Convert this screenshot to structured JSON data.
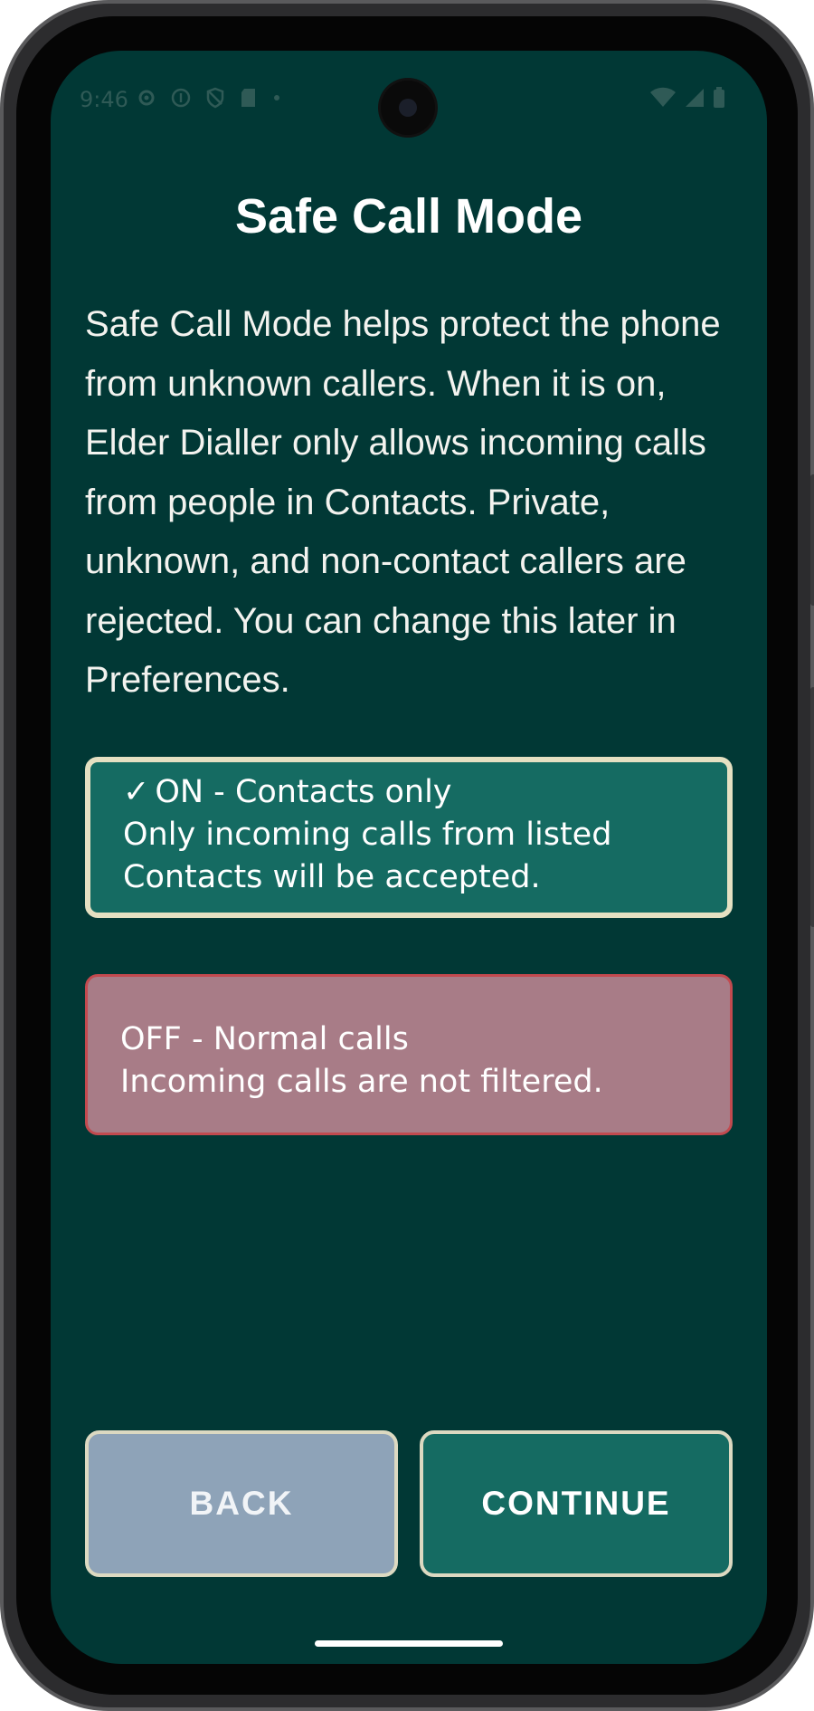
{
  "status_bar": {
    "time": "9:46",
    "left_icons": [
      "settings-icon",
      "info-icon",
      "shield-icon",
      "sd-card-icon",
      "dot-icon"
    ],
    "right_icons": [
      "wifi-icon",
      "signal-icon",
      "battery-icon"
    ]
  },
  "screen": {
    "title": "Safe Call Mode",
    "description": "Safe Call Mode helps protect the phone from unknown callers. When it is on, Elder Dialler only allows incoming calls from people in Contacts. Private, unknown, and non-contact callers are rejected. You can change this later in Preferences."
  },
  "options": {
    "on": {
      "selected": true,
      "check": "✓",
      "title": "ON - Contacts only",
      "line1": "Only incoming calls from listed",
      "line2": "Contacts will be accepted."
    },
    "off": {
      "selected": false,
      "title": "OFF - Normal calls",
      "subtitle": "Incoming calls are not filtered."
    }
  },
  "buttons": {
    "back": "BACK",
    "continue": "CONTINUE"
  },
  "colors": {
    "background": "#013835",
    "on_option": "#156b62",
    "on_border": "#e5e0c2",
    "off_option": "#a87c87",
    "off_border": "#c24a4f",
    "back_button": "#8ea3b8",
    "continue_button": "#156b62"
  }
}
